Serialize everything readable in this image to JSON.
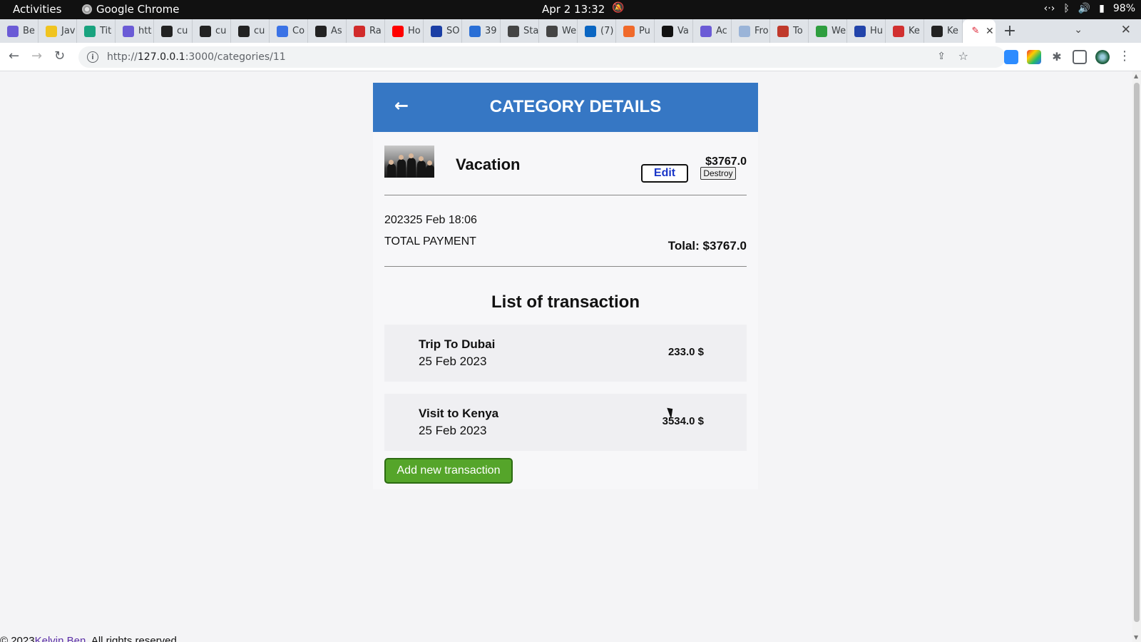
{
  "system": {
    "activities": "Activities",
    "app_name": "Google Chrome",
    "clock": "Apr 2  13:32",
    "battery": "98%"
  },
  "tabs": [
    {
      "label": "Be",
      "icon": "tab-favicon-purple",
      "color": "#6b5bd6"
    },
    {
      "label": "Jav",
      "icon": "tab-favicon-js",
      "color": "#f0c420"
    },
    {
      "label": "Tit",
      "icon": "tab-favicon-chatgpt",
      "color": "#19a37f"
    },
    {
      "label": "htt",
      "icon": "tab-favicon-purple",
      "color": "#6b5bd6"
    },
    {
      "label": "cu",
      "icon": "tab-favicon-github",
      "color": "#222222"
    },
    {
      "label": "cu",
      "icon": "tab-favicon-github",
      "color": "#222222"
    },
    {
      "label": "cu",
      "icon": "tab-favicon-github",
      "color": "#222222"
    },
    {
      "label": "Co",
      "icon": "tab-favicon-docs",
      "color": "#3b73e6"
    },
    {
      "label": "As",
      "icon": "tab-favicon-github",
      "color": "#222222"
    },
    {
      "label": "Ra",
      "icon": "tab-favicon-red",
      "color": "#d12b2b"
    },
    {
      "label": "Ho",
      "icon": "tab-favicon-youtube",
      "color": "#ff0000"
    },
    {
      "label": "SO",
      "icon": "tab-favicon-notion",
      "color": "#1b3fa5"
    },
    {
      "label": "39",
      "icon": "tab-favicon-blue",
      "color": "#2a6fd6"
    },
    {
      "label": "Sta",
      "icon": "tab-favicon-wiki",
      "color": "#444444"
    },
    {
      "label": "We",
      "icon": "tab-favicon-wiki",
      "color": "#444444"
    },
    {
      "label": "(7)",
      "icon": "tab-favicon-linkedin",
      "color": "#0a66c2"
    },
    {
      "label": "Pu",
      "icon": "tab-favicon-orange",
      "color": "#f06a2b"
    },
    {
      "label": "Va",
      "icon": "tab-favicon-dev",
      "color": "#111111"
    },
    {
      "label": "Ac",
      "icon": "tab-favicon-card",
      "color": "#6b5bd6"
    },
    {
      "label": "Fro",
      "icon": "tab-favicon-light",
      "color": "#9ab4d8"
    },
    {
      "label": "To",
      "icon": "tab-favicon-red",
      "color": "#c0392b"
    },
    {
      "label": "We",
      "icon": "tab-favicon-green",
      "color": "#2e9e3f"
    },
    {
      "label": "Hu",
      "icon": "tab-favicon-multi",
      "color": "#2244aa"
    },
    {
      "label": "Ke",
      "icon": "tab-favicon-red",
      "color": "#d13030"
    },
    {
      "label": "Ke",
      "icon": "tab-favicon-github",
      "color": "#222222"
    }
  ],
  "address": {
    "scheme": "http://",
    "host": "127.0.0.1",
    "path": ":3000/categories/11"
  },
  "header": {
    "title": "CATEGORY DETAILS"
  },
  "category": {
    "name": "Vacation",
    "amount": "$3767.0",
    "edit_label": "Edit",
    "destroy_label": "Destroy",
    "date": "202325 Feb 18:06",
    "total_label": "TOTAL PAYMENT",
    "total_value": "Tolal: $3767.0"
  },
  "transactions": {
    "title": "List of transaction",
    "items": [
      {
        "name": "Trip To Dubai",
        "date": "25 Feb 2023",
        "amount": "233.0 $"
      },
      {
        "name": "Visit to Kenya",
        "date": "25 Feb 2023",
        "amount": "3534.0 $"
      }
    ],
    "add_label": "Add new transaction"
  },
  "footer": {
    "prefix": "© 2023",
    "author": "Kelvin Ben",
    "suffix": ". All rights reserved."
  },
  "colors": {
    "header_bg": "#3677c4",
    "add_button_bg": "#55a52a",
    "edit_text": "#1a36c8"
  }
}
